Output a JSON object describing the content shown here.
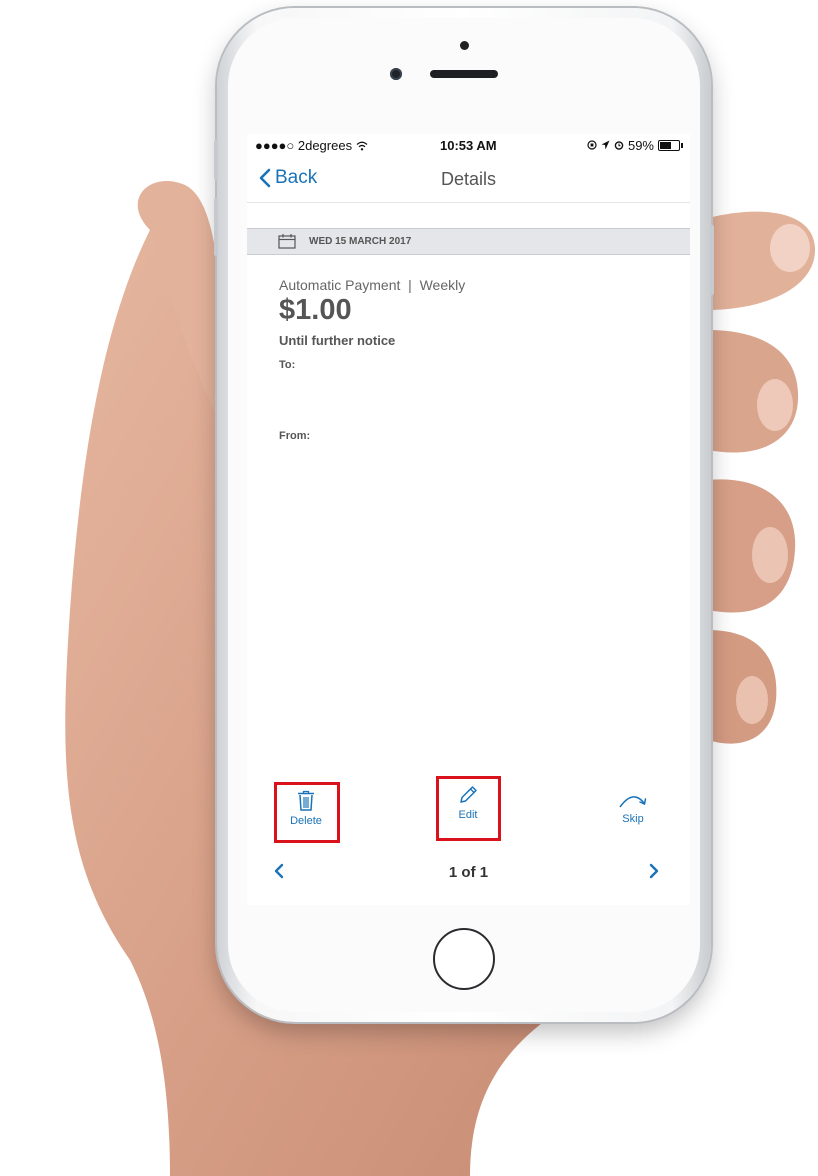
{
  "status_bar": {
    "carrier": "●●●●○ 2degrees",
    "time": "10:53 AM",
    "battery": "59%",
    "battery_level": 0.59
  },
  "nav": {
    "back_label": "Back",
    "title": "Details"
  },
  "date_bar": {
    "date": "WED 15 MARCH 2017"
  },
  "payment": {
    "type": "Automatic Payment  |  Weekly",
    "amount": "$1.00",
    "until": "Until further notice",
    "to_label": "To:",
    "from_label": "From:"
  },
  "actions": {
    "delete_label": "Delete",
    "edit_label": "Edit",
    "skip_label": "Skip"
  },
  "pager": {
    "text": "1 of 1"
  },
  "colors": {
    "accent": "#1a73b8",
    "highlight": "#d9121b",
    "date_bar_bg": "#e5e6ea"
  }
}
